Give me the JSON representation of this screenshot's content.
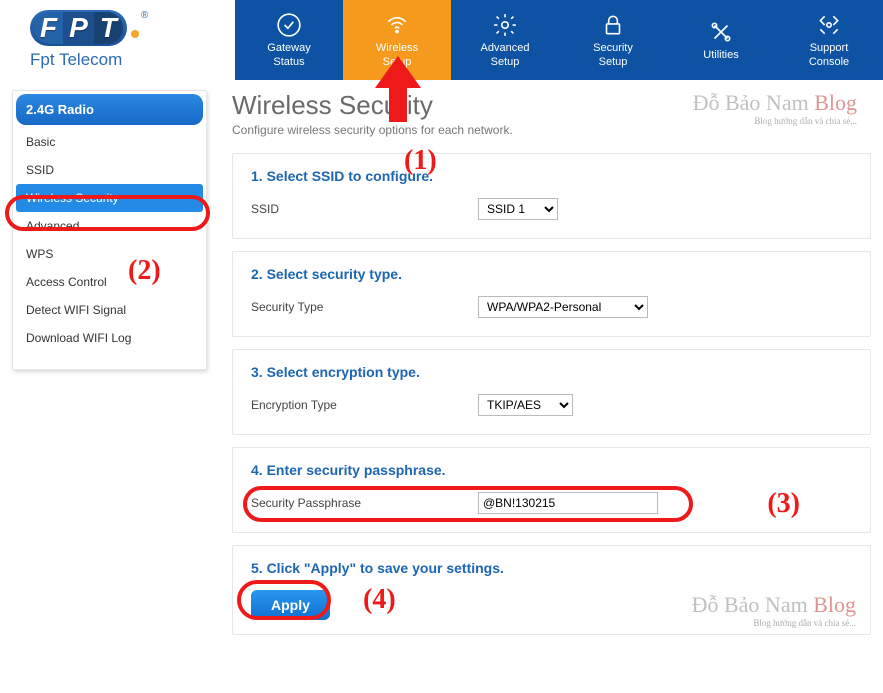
{
  "brand": {
    "name": "Fpt Telecom"
  },
  "topnav": [
    {
      "line1": "Gateway",
      "line2": "Status"
    },
    {
      "line1": "Wireless",
      "line2": "Setup"
    },
    {
      "line1": "Advanced",
      "line2": "Setup"
    },
    {
      "line1": "Security",
      "line2": "Setup"
    },
    {
      "line1": "Utilities",
      "line2": ""
    },
    {
      "line1": "Support",
      "line2": "Console"
    }
  ],
  "sidebar": {
    "header": "2.4G Radio",
    "items": [
      "Basic",
      "SSID",
      "Wireless Security",
      "Advanced",
      "WPS",
      "Access Control",
      "Detect WIFI Signal",
      "Download WIFI Log"
    ]
  },
  "page": {
    "title": "Wireless Security",
    "subtitle": "Configure wireless security options for each network."
  },
  "sections": {
    "s1": {
      "title": "1. Select SSID to configure.",
      "label": "SSID",
      "value": "SSID 1"
    },
    "s2": {
      "title": "2. Select security type.",
      "label": "Security Type",
      "value": "WPA/WPA2-Personal"
    },
    "s3": {
      "title": "3. Select encryption type.",
      "label": "Encryption Type",
      "value": "TKIP/AES"
    },
    "s4": {
      "title": "4. Enter security passphrase.",
      "label": "Security Passphrase",
      "value": "@BN!130215"
    },
    "s5": {
      "title": "5. Click \"Apply\" to save your settings.",
      "button": "Apply"
    }
  },
  "annotations": {
    "n1": "(1)",
    "n2": "(2)",
    "n3": "(3)",
    "n4": "(4)"
  },
  "watermark": {
    "big1": "Đỗ Bảo Nam ",
    "big2": "Blog",
    "small": "Blog hướng dẫn và chia sẻ..."
  }
}
